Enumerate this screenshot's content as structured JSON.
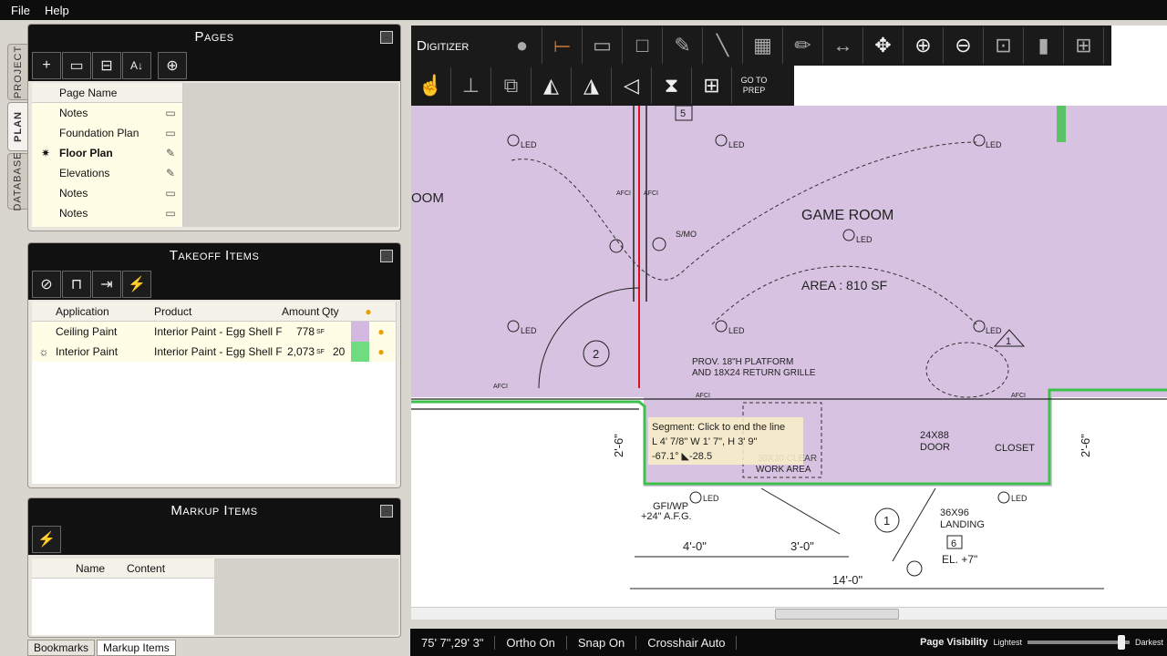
{
  "menu": {
    "file": "File",
    "help": "Help"
  },
  "vtabs": {
    "project": "PROJECT",
    "plan": "PLAN",
    "database": "DATABASE"
  },
  "pages": {
    "title": "Pages",
    "column": "Page Name",
    "items": [
      {
        "name": "Notes",
        "active": false,
        "icon": "ruler-icon"
      },
      {
        "name": "Foundation Plan",
        "active": false,
        "icon": "ruler-icon"
      },
      {
        "name": "Floor Plan",
        "active": true,
        "icon": "pencil-icon"
      },
      {
        "name": "Elevations",
        "active": false,
        "icon": "pencil-icon"
      },
      {
        "name": "Notes",
        "active": false,
        "icon": "ruler-icon"
      },
      {
        "name": "Notes",
        "active": false,
        "icon": "ruler-icon"
      }
    ]
  },
  "takeoff": {
    "title": "Takeoff Items",
    "columns": {
      "application": "Application",
      "product": "Product",
      "amount": "Amount",
      "qty": "Qty"
    },
    "rows": [
      {
        "application": "Ceiling Paint",
        "product": "Interior Paint - Egg Shell Fi",
        "amount": "778",
        "unit": "SF",
        "qty": "",
        "color": "#d3b9df"
      },
      {
        "application": "Interior Paint",
        "product": "Interior Paint - Egg Shell Fi",
        "amount": "2,073",
        "unit": "SF",
        "qty": "20",
        "color": "#6fdc7f"
      }
    ]
  },
  "markup": {
    "title": "Markup Items",
    "columns": {
      "name": "Name",
      "content": "Content"
    }
  },
  "bottom_tabs": {
    "bookmarks": "Bookmarks",
    "markup_items": "Markup Items"
  },
  "digitizer": {
    "title": "Digitizer",
    "go_to_prep": "GO TO PREP"
  },
  "plan": {
    "game_room": "GAME ROOM",
    "area": "AREA : 810 SF",
    "oom": "OOM",
    "platform_note_1": "PROV. 18\"H PLATFORM",
    "platform_note_2": "AND 18X24 RETURN GRILLE",
    "door": "24X88",
    "door2": "DOOR",
    "closet": "CLOSET",
    "landing_1": "36X96",
    "landing_2": "LANDING",
    "el": "EL. +7\"",
    "gfi_1": "GFI/WP",
    "gfi_2": "+24\" A.F.G.",
    "clear_1": "30X30 CLEAR",
    "clear_2": "WORK AREA",
    "dim_4": "4'-0\"",
    "dim_3": "3'-0\"",
    "dim_14": "14'-0\"",
    "dim_26a": "2'-6\"",
    "dim_26b": "2'-6\"",
    "tag_5": "5",
    "tag_6": "6",
    "circle_1": "1",
    "circle_2": "2",
    "tri_1": "1",
    "led": "LED",
    "afci": "AFCI",
    "smo": "S/MO",
    "tooltip": {
      "line1": "Segment: Click to end the line",
      "line2": "L 4' 7/8\"  W 1' 7\",  H 3' 9\"",
      "line3": "-67.1°  ◣-28.5"
    }
  },
  "status": {
    "coords": "75' 7\",29' 3\"",
    "ortho": "Ortho On",
    "snap": "Snap On",
    "crosshair": "Crosshair Auto",
    "visibility": "Page Visibility",
    "lightest": "Lightest",
    "darkest": "Darkest",
    "visibility_level": 0.95
  },
  "colors": {
    "room_fill": "#d8c2e2",
    "outline_green": "#3cc24a",
    "red_line": "#e0101c"
  }
}
